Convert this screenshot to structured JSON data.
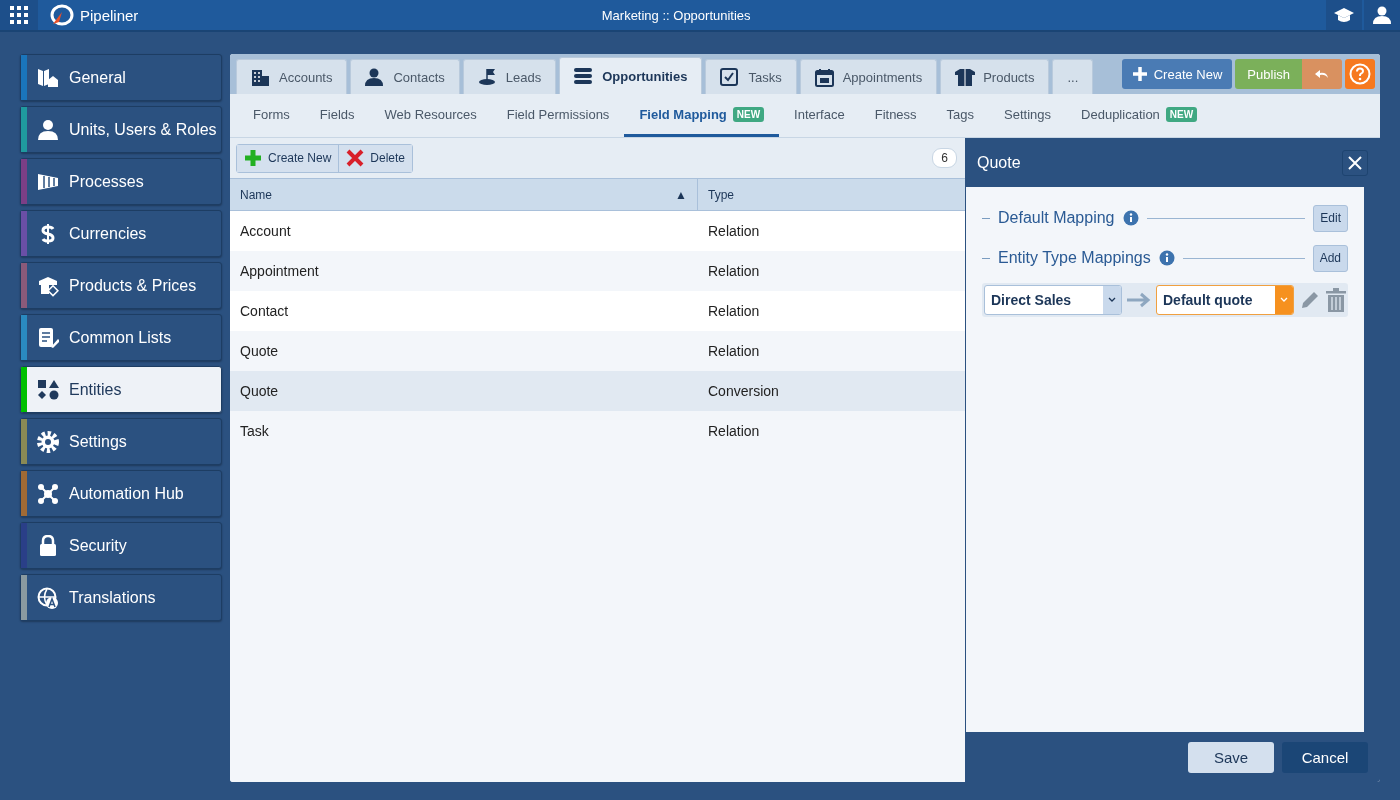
{
  "topbar": {
    "logo": "Pipeliner",
    "title": "Marketing :: Opportunities"
  },
  "sidebar": {
    "items": [
      {
        "label": "General",
        "color": "#1a75bb",
        "selected": false
      },
      {
        "label": "Units, Users & Roles",
        "color": "#1f9a9f",
        "selected": false
      },
      {
        "label": "Processes",
        "color": "#7b3f86",
        "selected": false
      },
      {
        "label": "Currencies",
        "color": "#6a4fa6",
        "selected": false
      },
      {
        "label": "Products & Prices",
        "color": "#8a5a7a",
        "selected": false
      },
      {
        "label": "Common Lists",
        "color": "#2a8ac0",
        "selected": false
      },
      {
        "label": "Entities",
        "color": "#00c000",
        "selected": true
      },
      {
        "label": "Settings",
        "color": "#8a8a55",
        "selected": false
      },
      {
        "label": "Automation Hub",
        "color": "#a06a35",
        "selected": false
      },
      {
        "label": "Security",
        "color": "#2a3f88",
        "selected": false
      },
      {
        "label": "Translations",
        "color": "#8a9aa0",
        "selected": false
      }
    ]
  },
  "tabs": [
    {
      "label": "Accounts",
      "selected": false
    },
    {
      "label": "Contacts",
      "selected": false
    },
    {
      "label": "Leads",
      "selected": false
    },
    {
      "label": "Opportunities",
      "selected": true
    },
    {
      "label": "Tasks",
      "selected": false
    },
    {
      "label": "Appointments",
      "selected": false
    },
    {
      "label": "Products",
      "selected": false
    },
    {
      "label": "...",
      "selected": false
    }
  ],
  "actions": {
    "create_new": "Create New",
    "publish": "Publish"
  },
  "subtabs": [
    {
      "label": "Forms",
      "selected": false
    },
    {
      "label": "Fields",
      "selected": false
    },
    {
      "label": "Web Resources",
      "selected": false
    },
    {
      "label": "Field Permissions",
      "selected": false
    },
    {
      "label": "Field Mapping",
      "badge": "NEW",
      "selected": true
    },
    {
      "label": "Interface",
      "selected": false
    },
    {
      "label": "Fitness",
      "selected": false
    },
    {
      "label": "Tags",
      "selected": false
    },
    {
      "label": "Settings",
      "selected": false
    },
    {
      "label": "Deduplication",
      "badge": "NEW",
      "selected": false
    }
  ],
  "toolbar": {
    "create_new": "Create New",
    "delete": "Delete",
    "count": "6"
  },
  "table": {
    "columns": [
      {
        "label": "Name",
        "sort": "▲"
      },
      {
        "label": "Type"
      }
    ],
    "rows": [
      {
        "name": "Account",
        "type": "Relation",
        "selected": false
      },
      {
        "name": "Appointment",
        "type": "Relation",
        "selected": false
      },
      {
        "name": "Contact",
        "type": "Relation",
        "selected": false
      },
      {
        "name": "Quote",
        "type": "Relation",
        "selected": false
      },
      {
        "name": "Quote",
        "type": "Conversion",
        "selected": true
      },
      {
        "name": "Task",
        "type": "Relation",
        "selected": false
      }
    ]
  },
  "panel": {
    "title": "Quote",
    "sections": [
      {
        "title": "Default Mapping",
        "button": "Edit"
      },
      {
        "title": "Entity Type Mappings",
        "button": "Add"
      }
    ],
    "mappings": [
      {
        "source": "Direct Sales",
        "target": "Default quote",
        "target_focused": true
      }
    ],
    "buttons": {
      "save": "Save",
      "cancel": "Cancel"
    }
  }
}
